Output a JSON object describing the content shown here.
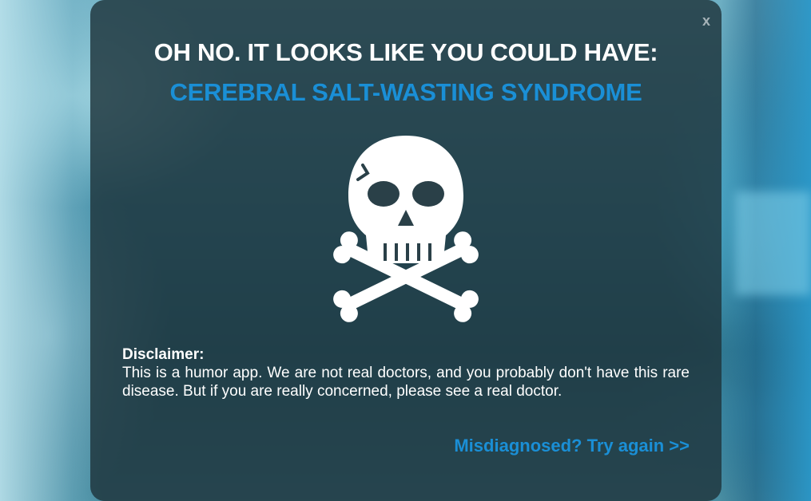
{
  "modal": {
    "close_label": "x",
    "headline": "OH NO. IT LOOKS LIKE YOU COULD HAVE:",
    "diagnosis": "CEREBRAL SALT-WASTING SYNDROME",
    "icon": "skull-and-crossbones-icon",
    "disclaimer_title": "Disclaimer:",
    "disclaimer_body": "This is a humor app. We are not real doctors, and you probably don't have this rare disease. But if you are really concerned, please see a real doctor.",
    "retry_link": "Misdiagnosed? Try again >>"
  },
  "colors": {
    "accent": "#1a8fd6",
    "modal_bg": "#1e343c",
    "text": "#ffffff"
  }
}
